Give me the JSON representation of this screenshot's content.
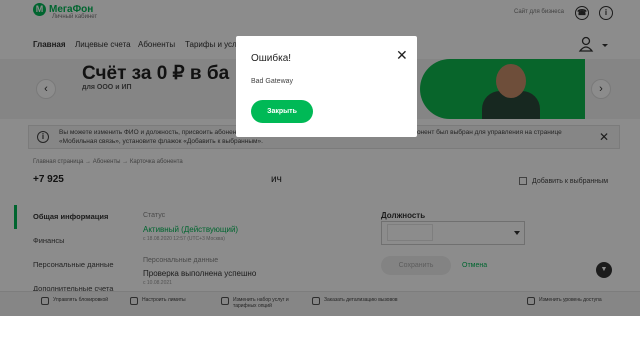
{
  "header": {
    "logo_text": "МегаФон",
    "logo_subtitle": "Личный кабинет",
    "business_link": "Сайт для бизнеса"
  },
  "nav": {
    "items": [
      "Главная",
      "Лицевые счета",
      "Абоненты",
      "Тарифы и услу"
    ]
  },
  "banner": {
    "title": "Счёт за 0 ₽ в ба",
    "subtitle": "для ООО и ИП",
    "prev_arrow": "‹",
    "next_arrow": "›"
  },
  "info_notice": {
    "text": "Вы можете изменить ФИО и должность, присвоить абонентов и совершать над ними однотипные операции. Чтобы абонент был выбран для управления на странице «Мобильная связь», установите флажок «Добавить к выбранным».",
    "close": "✕"
  },
  "breadcrumb": "Главная страница → Абоненты → Карточка абонента",
  "subscriber": {
    "phone_prefix": "+7 925",
    "phone_suffix": "ич",
    "add_to_selected": "Добавить к выбранным"
  },
  "sidebar": {
    "items": [
      "Общая информация",
      "Финансы",
      "Персональные данные",
      "Дополнительные счета"
    ]
  },
  "status": {
    "label": "Статус",
    "value": "Активный (Действующий)",
    "date": "с 18.08.2020 12:57 (UTC+3 Москва)"
  },
  "personal_data": {
    "label": "Персональные данные",
    "value": "Проверка выполнена успешно",
    "date": "с 10.08.2021"
  },
  "position": {
    "label": "Должность",
    "save_button": "Сохранить",
    "cancel_link": "Отмена"
  },
  "bottom_actions": [
    {
      "icon": "lock-icon",
      "label": "Управлять блокировкой"
    },
    {
      "icon": "settings-icon",
      "label": "Настроить лимиты"
    },
    {
      "icon": "services-icon",
      "label": "Изменить набор услуг и тарифных опций"
    },
    {
      "icon": "detail-icon",
      "label": "Заказать детализацию вызовов"
    },
    {
      "icon": "access-icon",
      "label": "Изменить уровень доступа"
    }
  ],
  "modal": {
    "title": "Ошибка!",
    "message": "Bad Gateway",
    "close_button": "Закрыть",
    "close_icon": "✕"
  },
  "colors": {
    "brand_green": "#00b956",
    "overlay": "rgba(0,0,0,0.45)"
  }
}
